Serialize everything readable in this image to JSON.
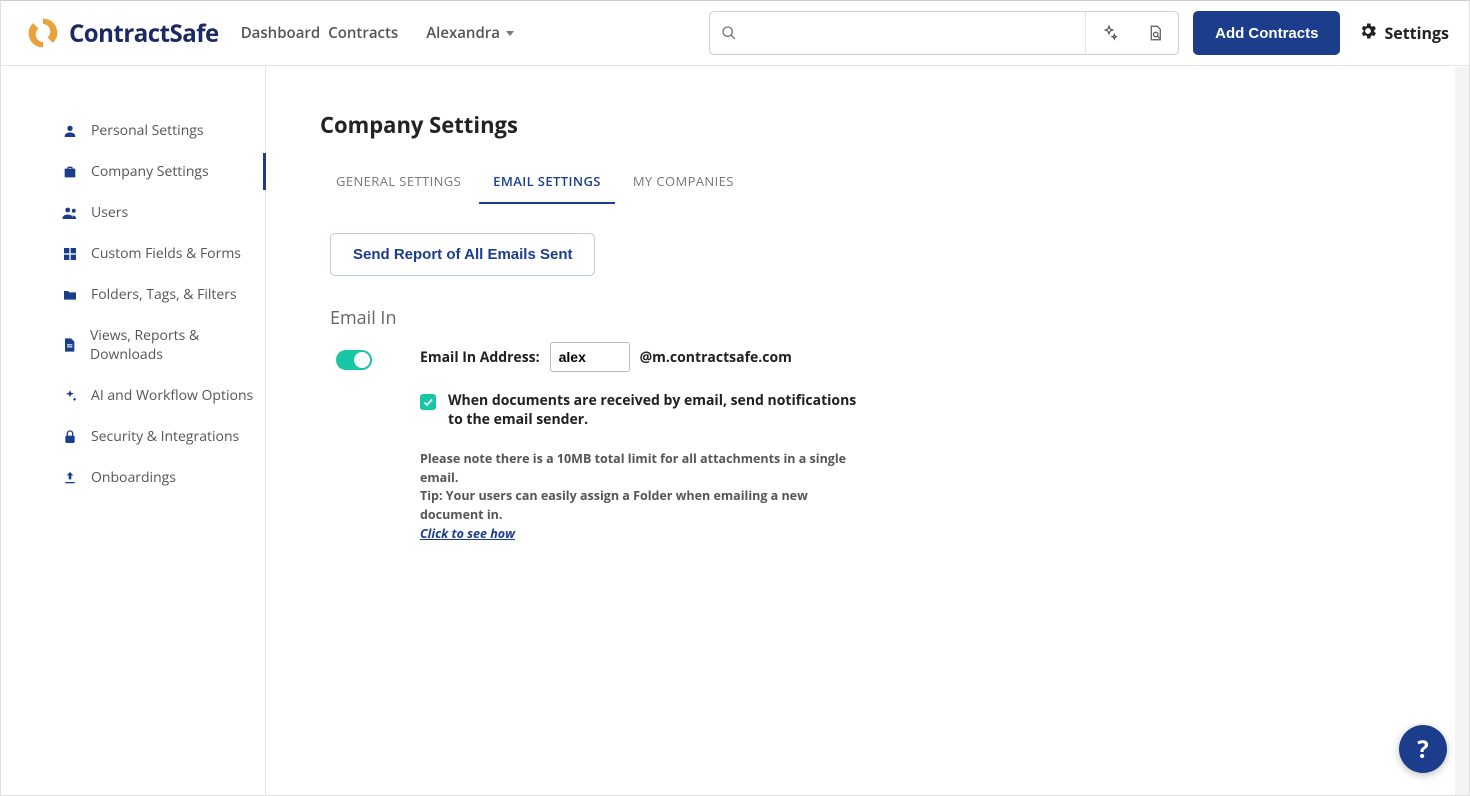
{
  "brand": "ContractSafe",
  "topnav": {
    "dashboard": "Dashboard",
    "contracts": "Contracts",
    "user": "Alexandra"
  },
  "header_buttons": {
    "add_contracts": "Add Contracts",
    "settings": "Settings"
  },
  "search": {
    "placeholder": ""
  },
  "sidebar": {
    "items": [
      {
        "icon": "person-icon",
        "label": "Personal Settings"
      },
      {
        "icon": "briefcase-icon",
        "label": "Company Settings",
        "active": true
      },
      {
        "icon": "users-icon",
        "label": "Users"
      },
      {
        "icon": "widgets-icon",
        "label": "Custom Fields & Forms"
      },
      {
        "icon": "folder-icon",
        "label": "Folders, Tags, & Filters"
      },
      {
        "icon": "file-icon",
        "label": "Views, Reports & Downloads"
      },
      {
        "icon": "sparkle-icon",
        "label": "AI and Workflow Options"
      },
      {
        "icon": "lock-icon",
        "label": "Security & Integrations"
      },
      {
        "icon": "upload-icon",
        "label": "Onboardings"
      }
    ]
  },
  "page": {
    "title": "Company Settings",
    "tabs": {
      "general": "GENERAL SETTINGS",
      "email": "EMAIL SETTINGS",
      "companies": "MY COMPANIES"
    },
    "send_report_btn": "Send Report of All Emails Sent",
    "email_in_heading": "Email In",
    "email_in_addr_label": "Email In Address:",
    "email_in_addr_value": "alex",
    "email_in_addr_suffix": "@m.contractsafe.com",
    "notify_checkbox_label": "When documents are received by email, send notifications to the email sender.",
    "note_line1": "Please note there is a 10MB total limit for all attachments in a single email.",
    "note_line2": "Tip: Your users can easily assign a Folder when emailing a new document in.",
    "note_link": "Click to see how"
  },
  "help_fab": "?"
}
